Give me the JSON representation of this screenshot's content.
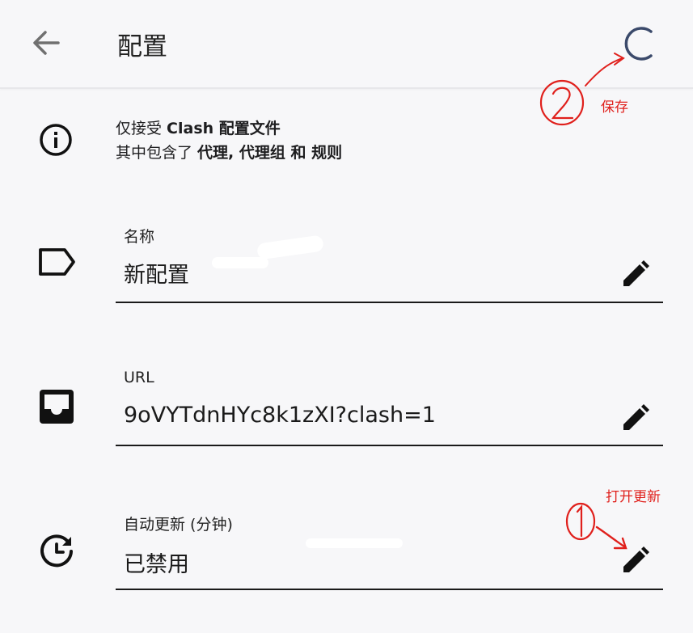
{
  "header": {
    "title": "配置",
    "back_icon": "arrow-back-icon",
    "save_icon": "save-refresh-icon"
  },
  "info": {
    "line1_prefix": "仅接受 ",
    "line1_bold": "Clash 配置文件",
    "line2_prefix": "其中包含了 ",
    "line2_bold": "代理, 代理组 和 规则"
  },
  "fields": {
    "name": {
      "label": "名称",
      "value": "新配置"
    },
    "url": {
      "label": "URL",
      "value": "9oVYTdnHYc8k1zXI?clash=1"
    },
    "auto_update": {
      "label": "自动更新 (分钟)",
      "value": "已禁用"
    }
  },
  "annotations": {
    "save_note": "保存",
    "update_note": "打开更新"
  },
  "colors": {
    "accent": "#3b4a6b",
    "annotation": "#e0201c",
    "background": "#f7f7f9"
  }
}
